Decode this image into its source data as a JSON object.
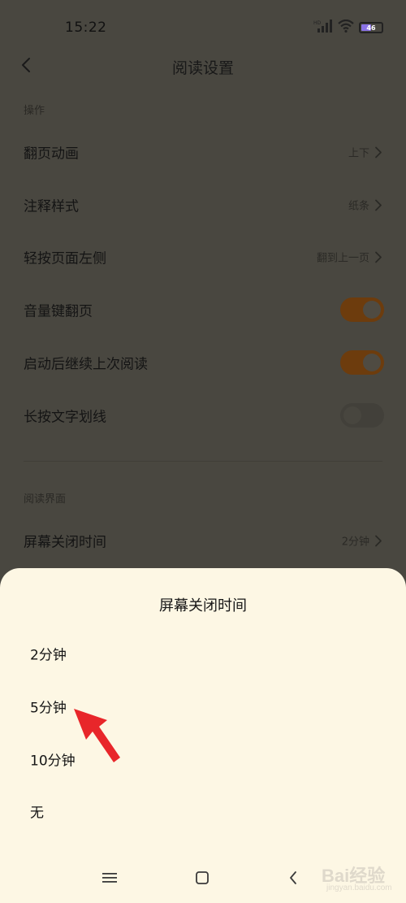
{
  "status_bar": {
    "time": "15:22",
    "battery_level": "46",
    "icons": [
      "hd-signal-icon",
      "wifi-icon",
      "battery-icon"
    ]
  },
  "header": {
    "title": "阅读设置",
    "back_icon": "chevron-left-icon"
  },
  "sections": [
    {
      "title": "操作",
      "rows": [
        {
          "label": "翻页动画",
          "value": "上下",
          "control": "chevron"
        },
        {
          "label": "注释样式",
          "value": "纸条",
          "control": "chevron"
        },
        {
          "label": "轻按页面左侧",
          "value": "翻到上一页",
          "control": "chevron"
        },
        {
          "label": "音量键翻页",
          "control": "toggle",
          "state": "on"
        },
        {
          "label": "启动后继续上次阅读",
          "control": "toggle",
          "state": "on"
        },
        {
          "label": "长按文字划线",
          "control": "toggle",
          "state": "off"
        }
      ]
    },
    {
      "title": "阅读界面",
      "rows": [
        {
          "label": "屏幕关闭时间",
          "value": "2分钟",
          "control": "chevron"
        }
      ]
    }
  ],
  "sheet": {
    "title": "屏幕关闭时间",
    "options": [
      "2分钟",
      "5分钟",
      "10分钟",
      "无"
    ]
  },
  "nav_bar": {
    "icons": [
      "menu-icon",
      "home-icon",
      "back-icon"
    ]
  },
  "watermark": {
    "text": "Bai经验",
    "subtext": "jingyan.baidu.com"
  },
  "colors": {
    "accent_toggle": "#6d3c0d",
    "sheet_bg": "#fdf7e4",
    "overlay_bg": "#494740",
    "pointer_arrow": "#e8262a"
  }
}
